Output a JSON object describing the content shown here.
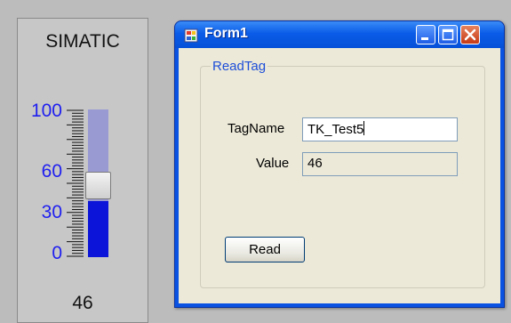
{
  "gauge": {
    "title": "SIMATIC",
    "scale": [
      "100",
      "60",
      "30",
      "0"
    ],
    "value": "46",
    "fill_color": "#0b14d8",
    "label_color": "#1f1ff0"
  },
  "window": {
    "title": "Form1",
    "icons": [
      "app-icon",
      "minimize-icon",
      "maximize-icon",
      "close-icon"
    ]
  },
  "form": {
    "group_label": "ReadTag",
    "tagname_label": "TagName",
    "tagname_value": "TK_Test5",
    "value_label": "Value",
    "value_value": "46",
    "read_button": "Read"
  }
}
